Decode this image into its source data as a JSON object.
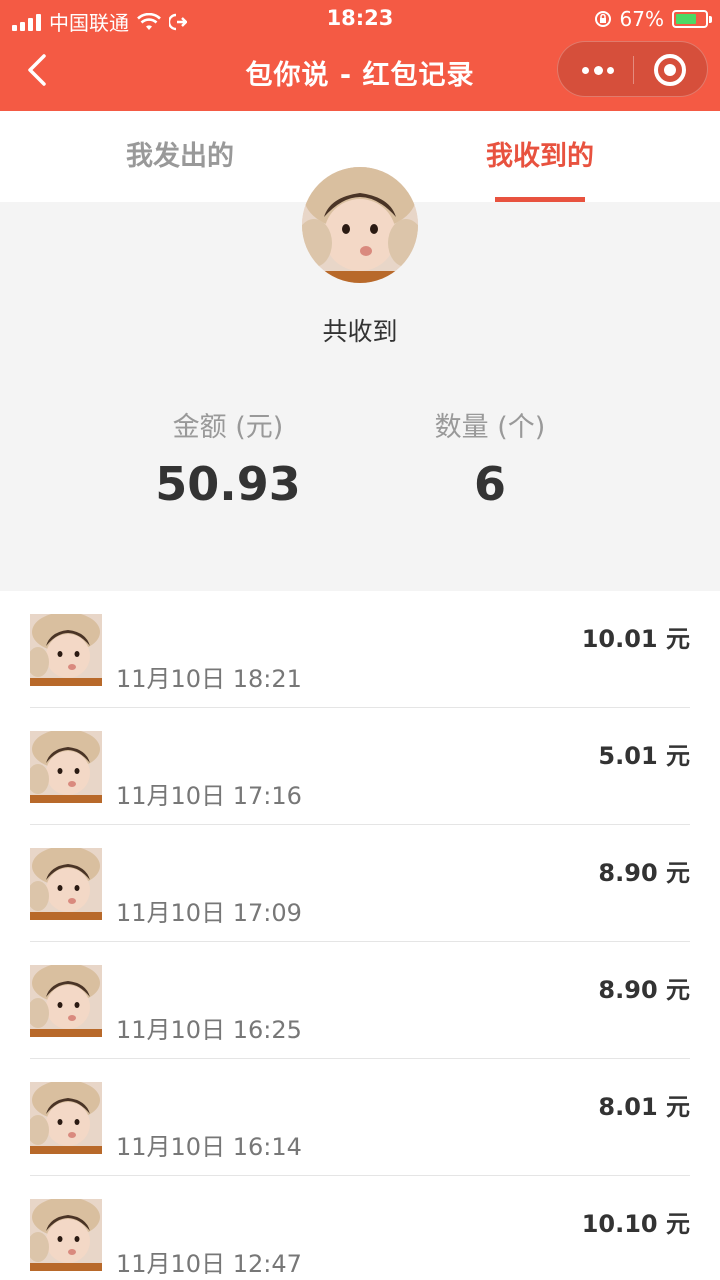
{
  "status": {
    "carrier": "中国联通",
    "time": "18:23",
    "battery": "67%"
  },
  "nav": {
    "title": "包你说 - 红包记录"
  },
  "tabs": [
    {
      "label": "我发出的",
      "active": false
    },
    {
      "label": "我收到的",
      "active": true
    }
  ],
  "summary": {
    "label": "共收到",
    "amount_label": "金额 (元)",
    "amount": "50.93",
    "count_label": "数量 (个)",
    "count": "6"
  },
  "records": [
    {
      "time": "11月10日 18:21",
      "amount": "10.01 元"
    },
    {
      "time": "11月10日 17:16",
      "amount": "5.01 元"
    },
    {
      "time": "11月10日 17:09",
      "amount": "8.90 元"
    },
    {
      "time": "11月10日 16:25",
      "amount": "8.90 元"
    },
    {
      "time": "11月10日 16:14",
      "amount": "8.01 元"
    },
    {
      "time": "11月10日 12:47",
      "amount": "10.10 元"
    }
  ],
  "colors": {
    "brand": "#f45a44",
    "active_tab": "#e8523f"
  }
}
